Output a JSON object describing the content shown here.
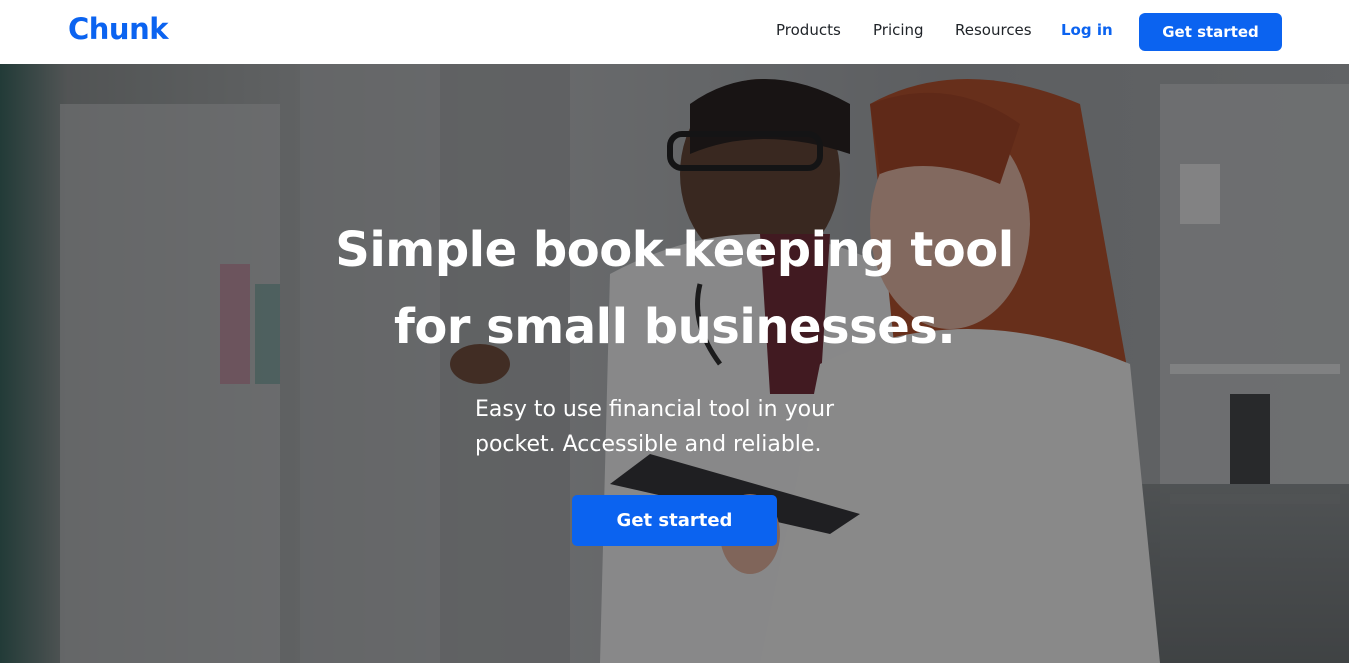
{
  "brand": {
    "logo_text": "Chunk",
    "accent_color": "#0b63f0"
  },
  "nav": {
    "links": [
      {
        "label": "Products"
      },
      {
        "label": "Pricing"
      },
      {
        "label": "Resources"
      }
    ],
    "login_label": "Log in",
    "cta_label": "Get started"
  },
  "hero": {
    "title_line1": "Simple book-keeping tool",
    "title_line2": "for small businesses.",
    "subtitle_line1": "Easy to use financial tool in your",
    "subtitle_line2": "pocket. Accessible and reliable.",
    "cta_label": "Get started",
    "image_description_icon": "hero-photo"
  }
}
